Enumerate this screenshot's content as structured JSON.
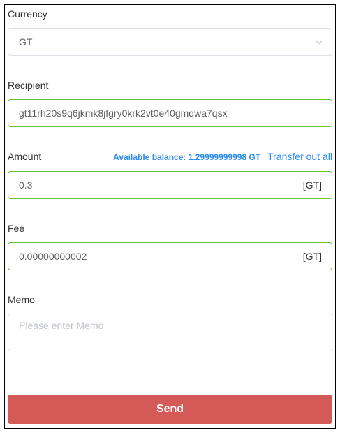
{
  "form": {
    "currency": {
      "label": "Currency",
      "value": "GT",
      "icon": "chevron-down-icon"
    },
    "recipient": {
      "label": "Recipient",
      "value": "gt11rh20s9q6jkmk8jfgry0krk2vt0e40gmqwa7qsx"
    },
    "amount": {
      "label": "Amount",
      "available_balance": "Available balance: 1.29999999998 GT",
      "transfer_all_label": "Transfer out all",
      "value": "0.3",
      "unit": "[GT]"
    },
    "fee": {
      "label": "Fee",
      "value": "0.00000000002",
      "unit": "[GT]"
    },
    "memo": {
      "label": "Memo",
      "placeholder": "Please enter Memo"
    },
    "send_label": "Send"
  },
  "colors": {
    "valid_border": "#67c23a",
    "link": "#2d8cf0",
    "send_button": "#d45a57"
  }
}
